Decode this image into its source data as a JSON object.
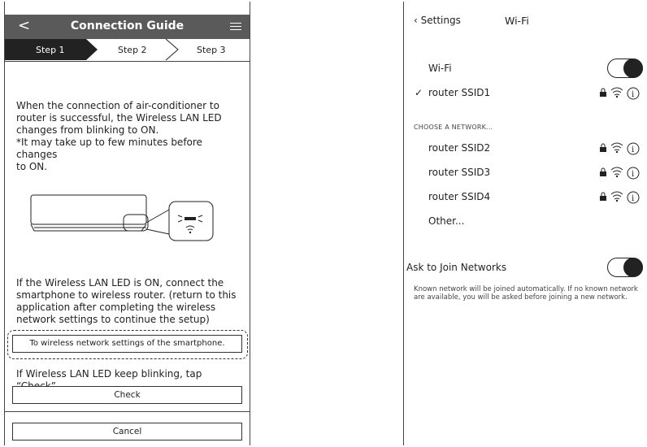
{
  "guide": {
    "title": "Connection Guide",
    "steps": [
      "Step 1",
      "Step 2",
      "Step 3"
    ],
    "intro_lines": [
      "When the connection of air-conditioner to",
      "router is successful, the Wireless LAN LED",
      "changes from blinking to ON.",
      "*It may take up to few minutes before changes",
      "to ON."
    ],
    "connect_lines": [
      "If the Wireless LAN LED is ON, connect the",
      "smartphone to wireless router. (return to this",
      "application after completing the wireless",
      "network settings to continue the setup)"
    ],
    "wifi_settings_button": "To wireless network settings of the smartphone.",
    "blink_text": "If Wireless LAN LED keep blinking, tap “Check”",
    "check_button": "Check",
    "cancel_button": "Cancel",
    "icons": [
      "back-arrow-icon",
      "hamburger-menu-icon",
      "air-conditioner-icon",
      "wifi-led-icon"
    ]
  },
  "wifi": {
    "back_label": "Settings",
    "title": "Wi-Fi",
    "wifi_label": "Wi-Fi",
    "connected_network": "router SSID1",
    "choose_header": "CHOOSE A NETWORK...",
    "networks": [
      "router SSID2",
      "router SSID3",
      "router SSID4"
    ],
    "other_label": "Other...",
    "ask_join_label": "Ask to Join Networks",
    "ask_join_desc": "Known network will be joined automatically. If no known network are available, you will be asked before joining a new network.",
    "wifi_on": true,
    "ask_join_on": true,
    "icons": [
      "chevron-left-icon",
      "checkmark-icon",
      "lock-icon",
      "wifi-signal-icon",
      "info-icon"
    ]
  }
}
